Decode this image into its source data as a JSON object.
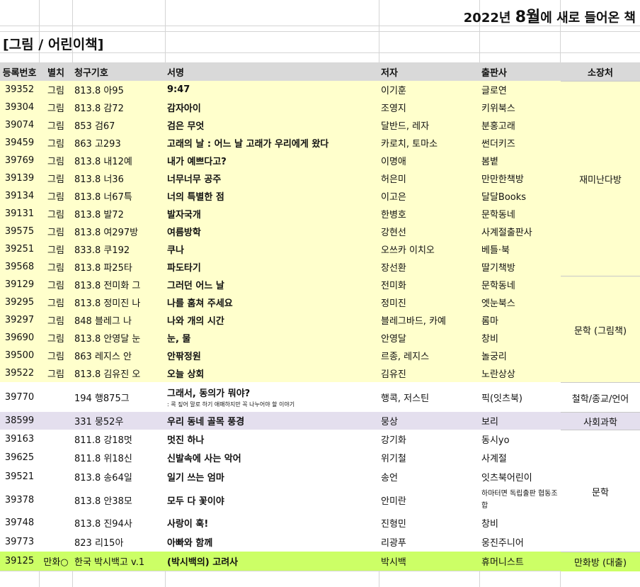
{
  "title": {
    "year": "2022년 ",
    "month": "8월",
    "rest": "에 새로 들어온 책"
  },
  "section": "[그림 / 어린이책]",
  "headers": {
    "no": "등록번호",
    "branch": "별치",
    "call": "청구기호",
    "title": "서명",
    "author": "저자",
    "publisher": "출판사",
    "location": "소장처"
  },
  "colors": {
    "yellow": "#ffffcc",
    "lavender": "#e4dfee",
    "green": "#ccff66",
    "header": "#d9d9d9"
  },
  "rows": [
    {
      "no": "39352",
      "branch": "그림",
      "call": "813.8 아95",
      "title": "9:47",
      "author": "이기훈",
      "publisher": "글로연"
    },
    {
      "no": "39304",
      "branch": "그림",
      "call": "813.8 감72",
      "title": "감자아이",
      "author": "조영지",
      "publisher": "키위북스"
    },
    {
      "no": "39074",
      "branch": "그림",
      "call": "853 검67",
      "title": "검은 무엇",
      "author": "달반드, 레자",
      "publisher": "분홍고래"
    },
    {
      "no": "39459",
      "branch": "그림",
      "call": "863 고293",
      "title": "고래의 날 : 어느 날 고래가 우리에게 왔다",
      "author": "카로치, 토마소",
      "publisher": "썬더키즈"
    },
    {
      "no": "39769",
      "branch": "그림",
      "call": "813.8 내12예",
      "title": "내가 예쁘다고?",
      "author": "이명애",
      "publisher": "봄볕"
    },
    {
      "no": "39139",
      "branch": "그림",
      "call": "813.8 너36",
      "title": "너무너무 공주",
      "author": "허은미",
      "publisher": "만만한책방"
    },
    {
      "no": "39134",
      "branch": "그림",
      "call": "813.8 너67특",
      "title": "너의 특별한 점",
      "author": "이고은",
      "publisher": "달달Books"
    },
    {
      "no": "39131",
      "branch": "그림",
      "call": "813.8 발72",
      "title": "발자국개",
      "author": "한병호",
      "publisher": "문학동네"
    },
    {
      "no": "39575",
      "branch": "그림",
      "call": "813.8 여297방",
      "title": "여름방학",
      "author": "강현선",
      "publisher": "사계절출판사"
    },
    {
      "no": "39251",
      "branch": "그림",
      "call": "833.8 쿠192",
      "title": "쿠나",
      "author": "오쓰카 이치오",
      "publisher": "베틀·북"
    },
    {
      "no": "39568",
      "branch": "그림",
      "call": "813.8 파25타",
      "title": "파도타기",
      "author": "장선환",
      "publisher": "딸기책방"
    },
    {
      "no": "39129",
      "branch": "그림",
      "call": "813.8 전미화 그",
      "title": "그러던 어느 날",
      "author": "전미화",
      "publisher": "문학동네"
    },
    {
      "no": "39295",
      "branch": "그림",
      "call": "813.8 정미진 나",
      "title": "나를 훔쳐 주세요",
      "author": "정미진",
      "publisher": "엣눈북스"
    },
    {
      "no": "39297",
      "branch": "그림",
      "call": "848 블레그 나",
      "title": "나와 개의 시간",
      "author": "블레그바드, 카예",
      "publisher": "롬마"
    },
    {
      "no": "39690",
      "branch": "그림",
      "call": "813.8 안영달 눈",
      "title": "눈, 물",
      "author": "안영달",
      "publisher": "창비"
    },
    {
      "no": "39500",
      "branch": "그림",
      "call": "863 레지스 안",
      "title": "안팎정원",
      "author": "르종, 레지스",
      "publisher": "놀궁리"
    },
    {
      "no": "39522",
      "branch": "그림",
      "call": "813.8 김유진 오",
      "title": "오늘 상회",
      "author": "김유진",
      "publisher": "노란상상"
    },
    {
      "no": "39770",
      "branch": "",
      "call": "194 행875그",
      "title": "그래서, 동의가 뭐야?",
      "subtitle": ": 콕 짚어 말로 하기 애매하지만 꼭 나누어야 할 이야기",
      "author": "행콕, 저스틴",
      "publisher": "픽(잇츠북)"
    },
    {
      "no": "38599",
      "branch": "",
      "call": "331 뭉52우",
      "title": "우리 동네 골목 풍경",
      "author": "뭉상",
      "publisher": "보리"
    },
    {
      "no": "39163",
      "branch": "",
      "call": "811.8 강18멋",
      "title": "멋진 하나",
      "author": "강기화",
      "publisher": "동시yo"
    },
    {
      "no": "39625",
      "branch": "",
      "call": "811.8 위18신",
      "title": "신발속에 사는 악어",
      "author": "위기철",
      "publisher": "사계절"
    },
    {
      "no": "39521",
      "branch": "",
      "call": "813.8 송64일",
      "title": "일기 쓰는 엄마",
      "author": "송언",
      "publisher": "잇츠북어린이"
    },
    {
      "no": "39378",
      "branch": "",
      "call": "813.8 안38모",
      "title": "모두 다 꽃이야",
      "author": "안미란",
      "publisher": "하마터면 독립출판 협동조합"
    },
    {
      "no": "39748",
      "branch": "",
      "call": "813.8 진94사",
      "title": "사랑이 훅!",
      "author": "진형민",
      "publisher": "창비"
    },
    {
      "no": "39773",
      "branch": "",
      "call": "823 리15아",
      "title": "아빠와 함께",
      "author": "리광푸",
      "publisher": "웅진주니어"
    },
    {
      "no": "39125",
      "branch": "만화○",
      "call": "한국 박시백고 v.1",
      "title": "(박시백의) 고려사",
      "author": "박시백",
      "publisher": "휴머니스트"
    }
  ],
  "locations": [
    "재미난다방",
    "문학 (그림책)",
    "철학/종교/언어",
    "사회과학",
    "문학",
    "만화방 (대출)"
  ]
}
